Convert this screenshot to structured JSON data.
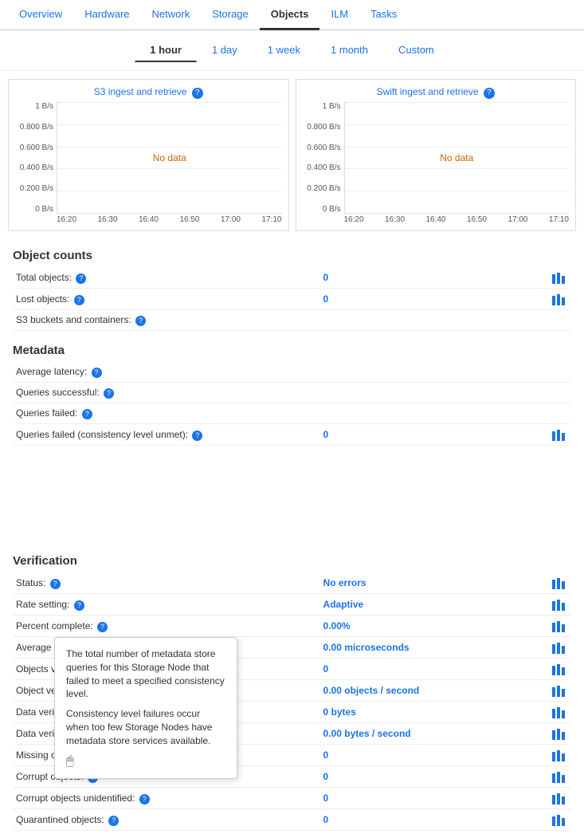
{
  "nav": {
    "items": [
      "Overview",
      "Hardware",
      "Network",
      "Storage",
      "Objects",
      "ILM",
      "Tasks"
    ],
    "active": "Objects"
  },
  "timeTabs": {
    "items": [
      "1 hour",
      "1 day",
      "1 week",
      "1 month",
      "Custom"
    ],
    "active": "1 hour"
  },
  "charts": [
    {
      "title": "S3 ingest and retrieve",
      "noData": "No data",
      "yAxis": [
        "1 B/s",
        "0.800 B/s",
        "0.600 B/s",
        "0.400 B/s",
        "0.200 B/s",
        "0 B/s"
      ],
      "xAxis": [
        "16:20",
        "16:30",
        "16:40",
        "16:50",
        "17:00",
        "17:10"
      ]
    },
    {
      "title": "Swift ingest and retrieve",
      "noData": "No data",
      "yAxis": [
        "1 B/s",
        "0.800 B/s",
        "0.600 B/s",
        "0.400 B/s",
        "0.200 B/s",
        "0 B/s"
      ],
      "xAxis": [
        "16:20",
        "16:30",
        "16:40",
        "16:50",
        "17:00",
        "17:10"
      ]
    }
  ],
  "objectCounts": {
    "title": "Object counts",
    "rows": [
      {
        "label": "Total objects:",
        "value": "0",
        "hasQ": true
      },
      {
        "label": "Lost objects:",
        "value": "0",
        "hasQ": true
      },
      {
        "label": "S3 buckets and containers:",
        "value": "",
        "hasQ": true
      }
    ]
  },
  "metadata": {
    "title": "Metadata",
    "rows": [
      {
        "label": "Average latency:",
        "value": "",
        "hasQ": true
      },
      {
        "label": "Queries successful:",
        "value": "",
        "hasQ": true
      },
      {
        "label": "Queries failed:",
        "value": "",
        "hasQ": true
      },
      {
        "label": "Queries failed (consistency level unmet):",
        "value": "0",
        "hasQ": true
      }
    ]
  },
  "tooltip": {
    "p1": "The total number of metadata store queries for this Storage Node that failed to meet a specified consistency level.",
    "p2": "Consistency level failures occur when too few Storage Nodes have metadata store services available."
  },
  "verification": {
    "title": "Verification",
    "rows": [
      {
        "label": "Status:",
        "value": "No errors",
        "hasQ": true,
        "valueClass": "status-no-errors"
      },
      {
        "label": "Rate setting:",
        "value": "Adaptive",
        "hasQ": true,
        "valueClass": "status-adaptive"
      },
      {
        "label": "Percent complete:",
        "value": "0.00%",
        "hasQ": true,
        "valueClass": "status-val"
      },
      {
        "label": "Average stat time:",
        "value": "0.00 microseconds",
        "hasQ": true,
        "valueClass": "status-val"
      },
      {
        "label": "Objects verified:",
        "value": "0",
        "hasQ": true,
        "valueClass": ""
      },
      {
        "label": "Object verification rate:",
        "value": "0.00 objects / second",
        "hasQ": true,
        "valueClass": "status-val"
      },
      {
        "label": "Data verified:",
        "value": "0 bytes",
        "hasQ": true,
        "valueClass": ""
      },
      {
        "label": "Data verification rate:",
        "value": "0.00 bytes / second",
        "hasQ": true,
        "valueClass": "status-val"
      },
      {
        "label": "Missing objects:",
        "value": "0",
        "hasQ": true,
        "valueClass": ""
      },
      {
        "label": "Corrupt objects:",
        "value": "0",
        "hasQ": true,
        "valueClass": ""
      },
      {
        "label": "Corrupt objects unidentified:",
        "value": "0",
        "hasQ": true,
        "valueClass": ""
      },
      {
        "label": "Quarantined objects:",
        "value": "0",
        "hasQ": true,
        "valueClass": ""
      }
    ]
  }
}
